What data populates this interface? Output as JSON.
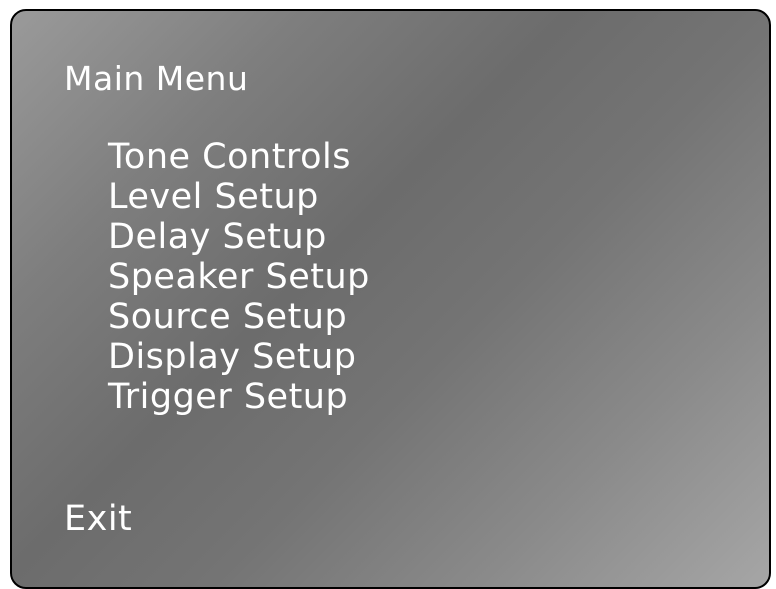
{
  "menu": {
    "title": "Main Menu",
    "items": [
      {
        "label": "Tone Controls"
      },
      {
        "label": "Level Setup"
      },
      {
        "label": "Delay Setup"
      },
      {
        "label": "Speaker Setup"
      },
      {
        "label": "Source Setup"
      },
      {
        "label": "Display Setup"
      },
      {
        "label": "Trigger Setup"
      }
    ],
    "exit_label": "Exit"
  }
}
